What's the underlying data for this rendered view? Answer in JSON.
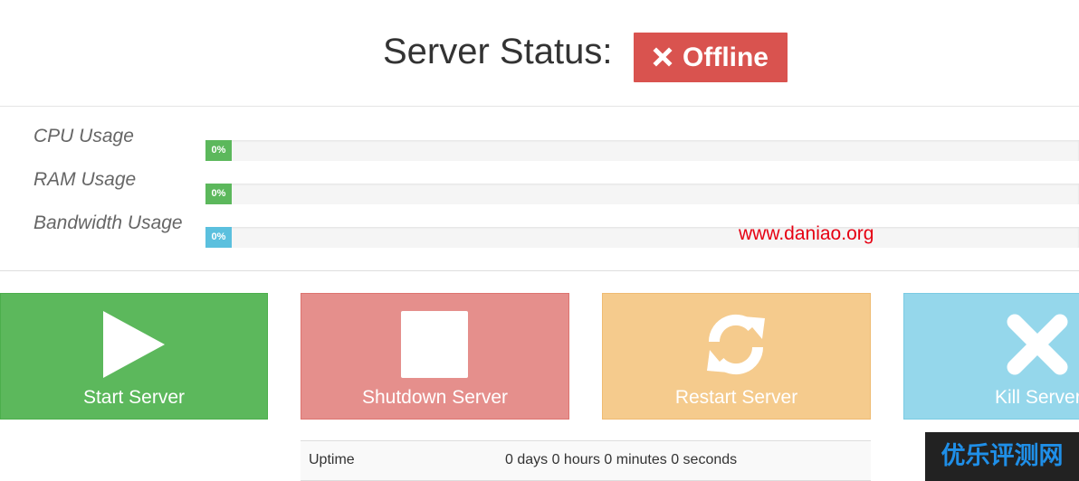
{
  "header": {
    "server_status_label": "Server Status:",
    "status_badge": {
      "label": "Offline",
      "icon": "close-icon",
      "color": "#d9534f"
    }
  },
  "usage": [
    {
      "label": "CPU Usage",
      "percent_text": "0%",
      "value_percent": 0,
      "color": "#5cb85c"
    },
    {
      "label": "RAM Usage",
      "percent_text": "0%",
      "value_percent": 0,
      "color": "#5cb85c"
    },
    {
      "label": "Bandwidth Usage",
      "percent_text": "0%",
      "value_percent": 0,
      "color": "#5bc0de"
    }
  ],
  "watermark": "www.daniao.org",
  "actions": [
    {
      "label": "Start Server",
      "icon": "play-icon",
      "color": "#5cb85c"
    },
    {
      "label": "Shutdown Server",
      "icon": "stop-icon",
      "color": "#e58f8c"
    },
    {
      "label": "Restart Server",
      "icon": "refresh-icon",
      "color": "#f5cb8d"
    },
    {
      "label": "Kill Server",
      "icon": "close-icon",
      "color": "#95d7eb"
    }
  ],
  "uptime": {
    "label": "Uptime",
    "value": "0 days 0 hours 0 minutes 0 seconds"
  },
  "corner_logo": "优乐评测网"
}
